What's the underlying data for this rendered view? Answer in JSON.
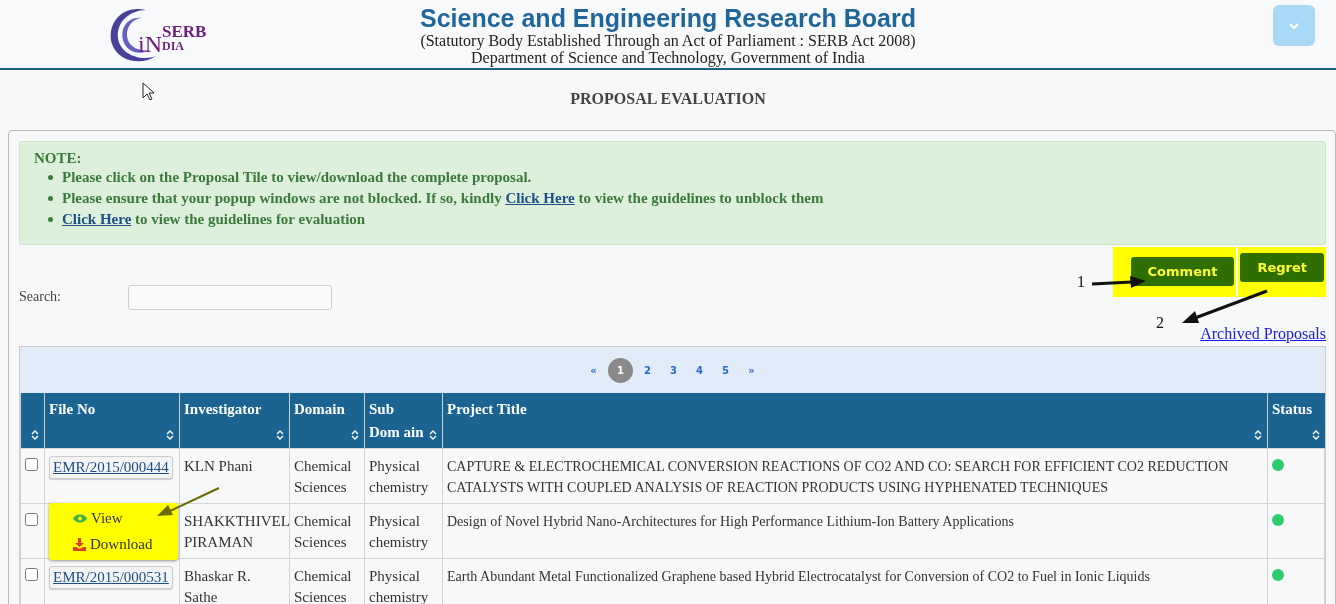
{
  "header": {
    "logo": {
      "mark": "iN",
      "top": "SERB",
      "bottom": "DIA"
    },
    "title": "Science and Engineering Research Board",
    "subtitle": "(Statutory Body Established Through an Act of Parliament : SERB Act 2008)",
    "department": "Department of Science and Technology, Government of India"
  },
  "page_title": "PROPOSAL EVALUATION",
  "note": {
    "heading": "NOTE:",
    "items": [
      {
        "after": "Please click on the Proposal Tile to view/download the complete proposal."
      },
      {
        "before": "Please ensure that your popup windows are not blocked. If so, kindly ",
        "link": "Click Here",
        "after": " to view the guidelines to unblock them"
      },
      {
        "link": "Click Here",
        "after": " to view the guidelines for evaluation"
      }
    ]
  },
  "actions": [
    {
      "label": "Comment",
      "highlighted": true
    },
    {
      "label": "Regret",
      "highlighted": true
    }
  ],
  "annotations": [
    "1",
    "2"
  ],
  "search": {
    "label": "Search:"
  },
  "archived_link": "Archived Proposals",
  "pagination": [
    {
      "label": "«",
      "selected": false
    },
    {
      "label": "1",
      "selected": true
    },
    {
      "label": "2",
      "selected": false
    },
    {
      "label": "3",
      "selected": false
    },
    {
      "label": "4",
      "selected": false
    },
    {
      "label": "5",
      "selected": false
    },
    {
      "label": "»",
      "selected": false
    }
  ],
  "table": {
    "columns": [
      {
        "kind": "select"
      },
      {
        "kind": "text",
        "label": "File No"
      },
      {
        "kind": "text",
        "label": "Investigator"
      },
      {
        "kind": "text",
        "label": "Domain"
      },
      {
        "kind": "text",
        "label": "Sub Dom ain"
      },
      {
        "kind": "text",
        "label": "Project Title"
      },
      {
        "kind": "text",
        "label": "Status"
      }
    ],
    "rows": [
      {
        "checked": false,
        "file_no": "EMR/2015/000444",
        "investigator": "KLN Phani",
        "domain": "Chemical Sciences",
        "sub_domain": "Physical chemistry",
        "title": "CAPTURE & ELECTROCHEMICAL CONVERSION REACTIONS OF CO2 AND CO: SEARCH FOR EFFICIENT CO2 REDUCTION CATALYSTS WITH COUPLED ANALYSIS OF REACTION PRODUCTS USING HYPHENATED TECHNIQUES",
        "color": "#2ecc71"
      },
      {
        "checked": false,
        "investigator": "SHAKKTHIVEL PIRAMAN",
        "domain": "Chemical Sciences",
        "sub_domain": "Physical chemistry",
        "title": "Design of Novel Hybrid Nano-Architectures for High Performance Lithium-Ion Battery Applications",
        "color": "#2ecc71"
      },
      {
        "checked": false,
        "file_no": "EMR/2015/000531",
        "investigator": "Bhaskar R. Sathe",
        "domain": "Chemical Sciences",
        "sub_domain": "Physical chemistry",
        "title": "Earth Abundant Metal Functionalized Graphene based Hybrid Electrocatalyst for Conversion of CO2 to Fuel in Ionic Liquids",
        "color": "#2ecc71"
      }
    ]
  },
  "popup_menu": [
    {
      "kind": "view",
      "label": "View"
    },
    {
      "kind": "download",
      "label": "Download"
    }
  ]
}
